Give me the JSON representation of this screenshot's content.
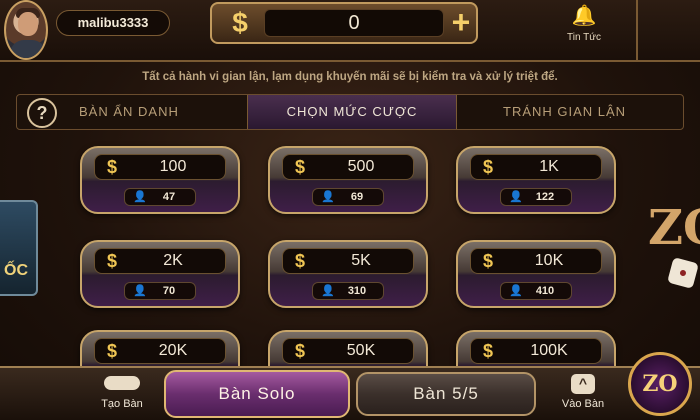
{
  "header": {
    "username": "malibu3333",
    "currency_symbol": "$",
    "balance": "0",
    "add_symbol": "+",
    "news_label": "Tin Tức"
  },
  "notice": "Tất cả hành vi gian lận, lạm dụng khuyến mãi sẽ bị kiểm tra và xử lý triệt để.",
  "tabs": {
    "help": "?",
    "items": [
      {
        "label": "BÀN ẨN DANH"
      },
      {
        "label": "CHỌN MỨC CƯỢC"
      },
      {
        "label": "TRÁNH GIAN LẬN"
      }
    ],
    "active_index": 1
  },
  "bets": [
    {
      "symbol": "$",
      "amount": "100",
      "players": "47"
    },
    {
      "symbol": "$",
      "amount": "500",
      "players": "69"
    },
    {
      "symbol": "$",
      "amount": "1K",
      "players": "122"
    },
    {
      "symbol": "$",
      "amount": "2K",
      "players": "70"
    },
    {
      "symbol": "$",
      "amount": "5K",
      "players": "310"
    },
    {
      "symbol": "$",
      "amount": "10K",
      "players": "410"
    },
    {
      "symbol": "$",
      "amount": "20K",
      "players": ""
    },
    {
      "symbol": "$",
      "amount": "50K",
      "players": ""
    },
    {
      "symbol": "$",
      "amount": "100K",
      "players": ""
    }
  ],
  "side": {
    "left_text": "ỐC",
    "right_logo": "ZO"
  },
  "bottom": {
    "create_label": "Tạo Bàn",
    "solo_label": "Bàn Solo",
    "five_label": "Bàn 5/5",
    "enter_label": "Vào Bàn",
    "enter_icon": "^",
    "corner_logo": "ZO"
  },
  "icons": {
    "bell": "bell-icon",
    "person": "person-icon",
    "help": "question-icon"
  },
  "colors": {
    "gold": "#f0c654",
    "purple": "#6a2e6e",
    "border": "#c7a56a"
  }
}
